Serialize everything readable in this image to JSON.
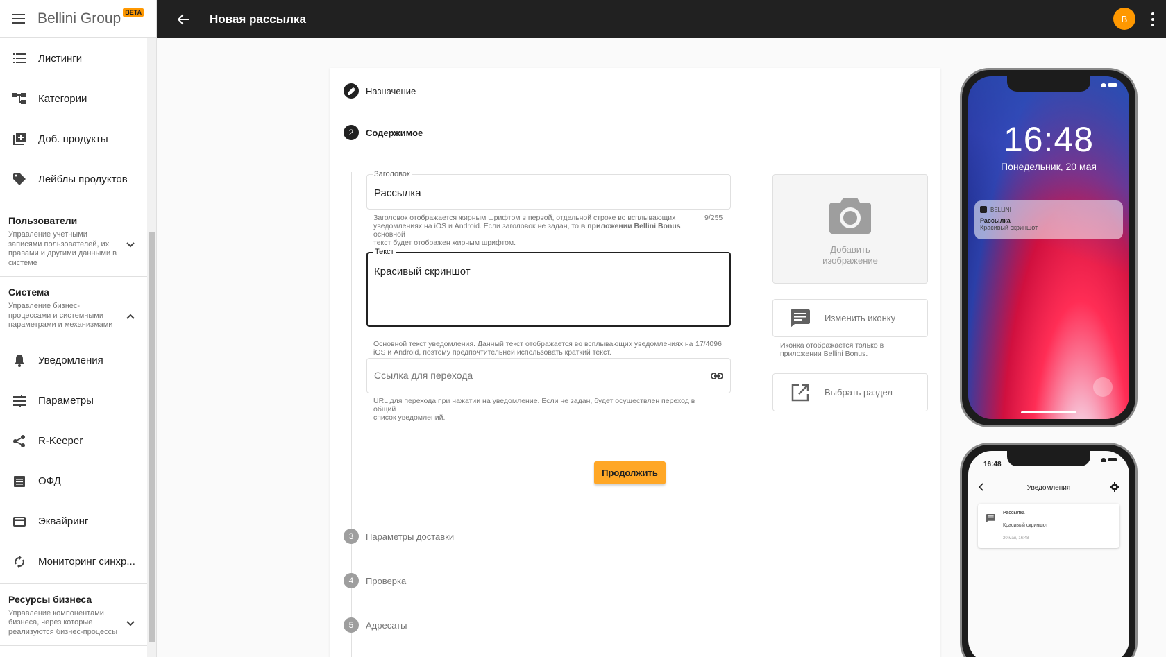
{
  "brand": {
    "name": "Bellini Group",
    "badge": "BETA"
  },
  "topbar": {
    "title": "Новая рассылка",
    "avatar_letter": "B"
  },
  "sidebar": {
    "items_top": [
      {
        "label": "Листинги",
        "icon": "list-icon"
      },
      {
        "label": "Категории",
        "icon": "category-tree-icon"
      },
      {
        "label": "Доб. продукты",
        "icon": "add-box-icon"
      },
      {
        "label": "Лейблы продуктов",
        "icon": "label-tag-icon"
      }
    ],
    "section_users": {
      "title": "Пользователи",
      "desc": "Управление учетными записями пользователей, их правами и другими данными в системе"
    },
    "section_system": {
      "title": "Система",
      "desc": "Управление бизнес-процессами и системными параметрами и механизмами"
    },
    "items_system": [
      {
        "label": "Уведомления",
        "icon": "bell-icon"
      },
      {
        "label": "Параметры",
        "icon": "tune-icon"
      },
      {
        "label": "R-Keeper",
        "icon": "share-icon"
      },
      {
        "label": "ОФД",
        "icon": "receipt-icon"
      },
      {
        "label": "Эквайринг",
        "icon": "credit-card-icon"
      },
      {
        "label": "Мониторинг синхр...",
        "icon": "sync-icon"
      }
    ],
    "section_resources": {
      "title": "Ресурсы бизнеса",
      "desc": "Управление компонентами бизнеса, через которые реализуются бизнес-процессы"
    }
  },
  "steps": {
    "s1": {
      "label": "Назначение"
    },
    "s2": {
      "num": "2",
      "label": "Содержимое"
    },
    "s3": {
      "num": "3",
      "label": "Параметры доставки"
    },
    "s4": {
      "num": "4",
      "label": "Проверка"
    },
    "s5": {
      "num": "5",
      "label": "Адресаты"
    }
  },
  "form": {
    "title_label": "Заголовок",
    "title_value": "Рассылка",
    "title_hint_1": "Заголовок отображается жирным шрифтом в первой, отдельной строке во всплывающих",
    "title_hint_2a": "уведомлениях на iOS и Android. Если заголовок не задан, то ",
    "title_hint_2b": "в приложении Bellini Bonus",
    "title_hint_2c": " основной",
    "title_hint_3": "текст будет отображен жирным шрифтом.",
    "title_counter": "9/255",
    "text_label": "Текст",
    "text_value": "Красивый скриншот",
    "text_hint_1": "Основной текст уведомления. Данный текст отображается во всплывающих уведомлениях на",
    "text_hint_2": "iOS и Android, поэтому предпочтительней использовать краткий текст.",
    "text_counter": "17/4096",
    "link_placeholder": "Ссылка для перехода",
    "link_hint_1": "URL для перехода при нажатии на уведомление. Если не задан, будет осуществлен переход в общий",
    "link_hint_2": "список уведомлений.",
    "add_image_1": "Добавить",
    "add_image_2": "изображение",
    "change_icon": "Изменить иконку",
    "icon_hint_1": "Иконка отображается только в",
    "icon_hint_2": "приложении Bellini Bonus.",
    "choose_section": "Выбрать раздел",
    "continue": "Продолжить"
  },
  "preview_lock": {
    "time": "16:48",
    "date": "Понедельник, 20 мая",
    "app_name": "BELLINI",
    "notif_title": "Рассылка",
    "notif_body": "Красивый скриншот"
  },
  "preview_app": {
    "status_time": "16:48",
    "header": "Уведомления",
    "card_title": "Рассылка",
    "card_body": "Красивый скриншот",
    "card_date": "20 мая, 16:48"
  },
  "colors": {
    "accent": "#ffa726",
    "topbar": "#212121",
    "avatar": "#ff9800"
  }
}
